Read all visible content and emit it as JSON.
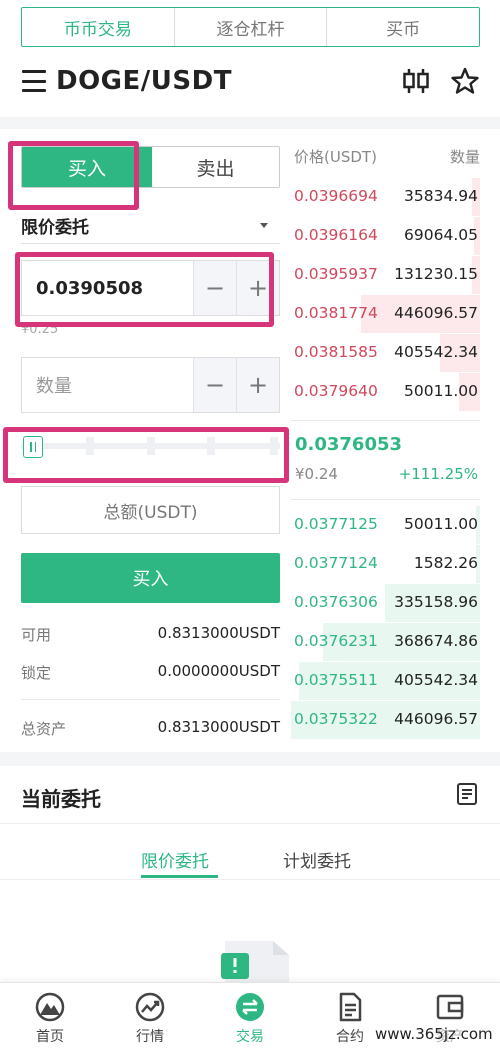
{
  "top_tabs": [
    "币币交易",
    "逐仓杠杆",
    "买币"
  ],
  "header": {
    "pair": "DOGE/USDT",
    "kline_icon": "candlestick-icon",
    "favorite_icon": "star-icon"
  },
  "trade": {
    "buy_tab": "买入",
    "sell_tab": "卖出",
    "order_type": "限价委托",
    "price_value": "0.0390508",
    "price_hint": "¥0.25",
    "amount_placeholder": "数量",
    "minus": "−",
    "plus": "+",
    "total_label": "总额(USDT)",
    "buy_button": "买入",
    "slider_percent": 0
  },
  "balance": [
    {
      "label": "可用",
      "value": "0.8313000USDT"
    },
    {
      "label": "锁定",
      "value": "0.0000000USDT"
    },
    {
      "label": "总资产",
      "value": "0.8313000USDT"
    }
  ],
  "orderbook": {
    "price_header": "价格(USDT)",
    "qty_header": "数量",
    "asks": [
      {
        "price": "0.0396694",
        "qty": "35834.94",
        "depth": 0.04
      },
      {
        "price": "0.0396164",
        "qty": "69064.05",
        "depth": 0.03
      },
      {
        "price": "0.0395937",
        "qty": "131230.15",
        "depth": 0.04
      },
      {
        "price": "0.0381774",
        "qty": "446096.57",
        "depth": 0.63
      },
      {
        "price": "0.0381585",
        "qty": "405542.34",
        "depth": 0.21
      },
      {
        "price": "0.0379640",
        "qty": "50011.00",
        "depth": 0.11
      }
    ],
    "last_price": "0.0376053",
    "last_cny": "¥0.24",
    "last_change": "+111.25%",
    "bids": [
      {
        "price": "0.0377125",
        "qty": "50011.00",
        "depth": 0.02
      },
      {
        "price": "0.0377124",
        "qty": "1582.26",
        "depth": 0.02
      },
      {
        "price": "0.0376306",
        "qty": "335158.96",
        "depth": 0.5
      },
      {
        "price": "0.0376231",
        "qty": "368674.86",
        "depth": 0.83
      },
      {
        "price": "0.0375511",
        "qty": "405542.34",
        "depth": 0.96
      },
      {
        "price": "0.0375322",
        "qty": "446096.57",
        "depth": 1.0
      }
    ]
  },
  "orders": {
    "title": "当前委托",
    "tab_limit": "限价委托",
    "tab_plan": "计划委托"
  },
  "bottom_nav": [
    {
      "label": "首页",
      "icon": "home-mountain-icon"
    },
    {
      "label": "行情",
      "icon": "market-chart-icon"
    },
    {
      "label": "交易",
      "icon": "trade-swap-icon"
    },
    {
      "label": "合约",
      "icon": "contract-doc-icon"
    },
    {
      "label": "资产",
      "icon": "wallet-icon"
    }
  ],
  "watermark": "www.365jz.com",
  "colors": {
    "green": "#2fb783",
    "red": "#d0485c",
    "highlight": "#d6357a"
  }
}
